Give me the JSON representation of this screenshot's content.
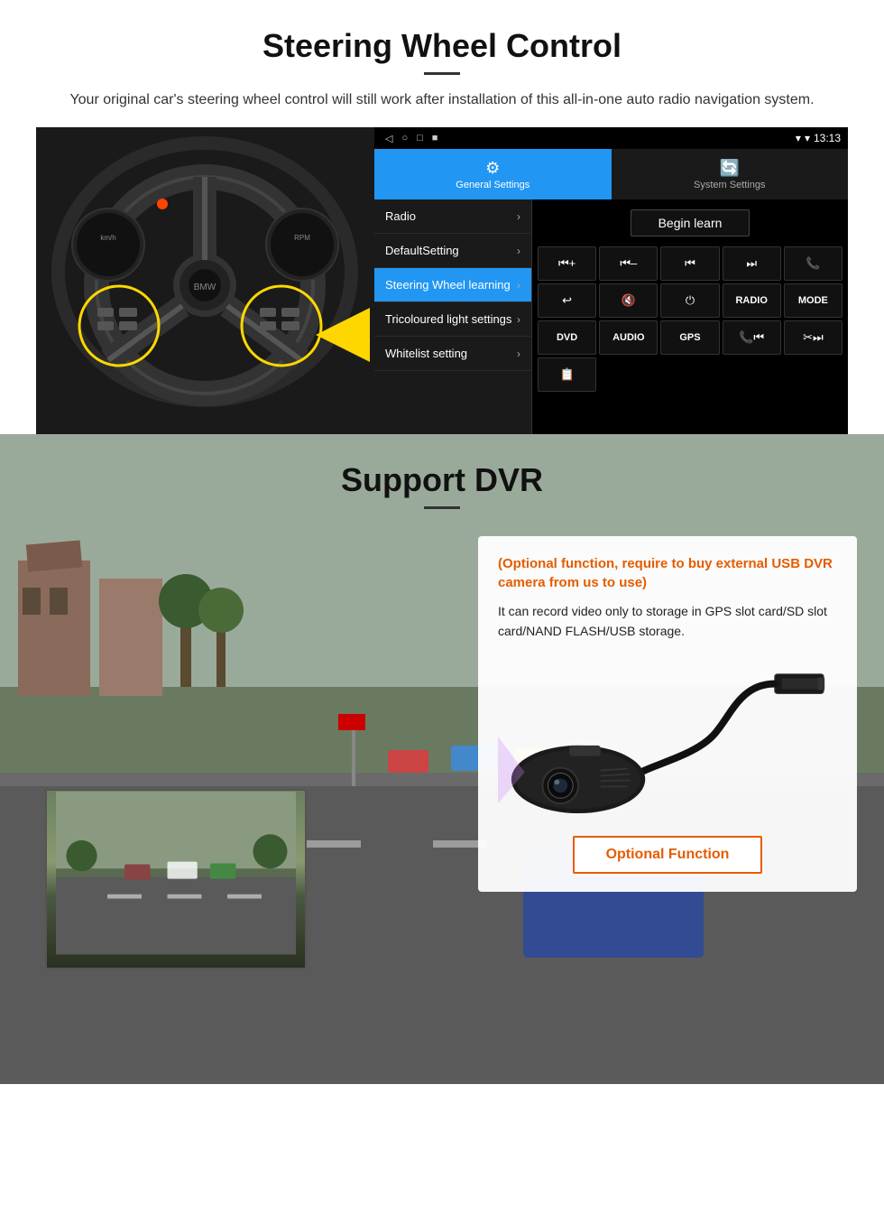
{
  "steering": {
    "title": "Steering Wheel Control",
    "subtitle": "Your original car's steering wheel control will still work after installation of this all-in-one auto radio navigation system.",
    "statusbar": {
      "time": "13:13",
      "nav_icons": [
        "◁",
        "○",
        "□",
        "■"
      ]
    },
    "tabs": {
      "general": "General Settings",
      "system": "System Settings"
    },
    "menu_items": [
      {
        "label": "Radio",
        "active": false
      },
      {
        "label": "DefaultSetting",
        "active": false
      },
      {
        "label": "Steering Wheel learning",
        "active": true
      },
      {
        "label": "Tricoloured light settings",
        "active": false
      },
      {
        "label": "Whitelist setting",
        "active": false
      }
    ],
    "begin_learn": "Begin learn",
    "controls": [
      "⏮+",
      "⏮–",
      "⏮⏮",
      "⏭⏭",
      "📞",
      "↩",
      "🔇x",
      "⏻",
      "RADIO",
      "MODE",
      "DVD",
      "AUDIO",
      "GPS",
      "📞⏮",
      "✂⏭"
    ],
    "extra_btn": "📋"
  },
  "dvr": {
    "title": "Support DVR",
    "optional_text": "(Optional function, require to buy external USB DVR camera from us to use)",
    "body_text": "It can record video only to storage in GPS slot card/SD slot card/NAND FLASH/USB storage.",
    "optional_btn": "Optional Function"
  }
}
